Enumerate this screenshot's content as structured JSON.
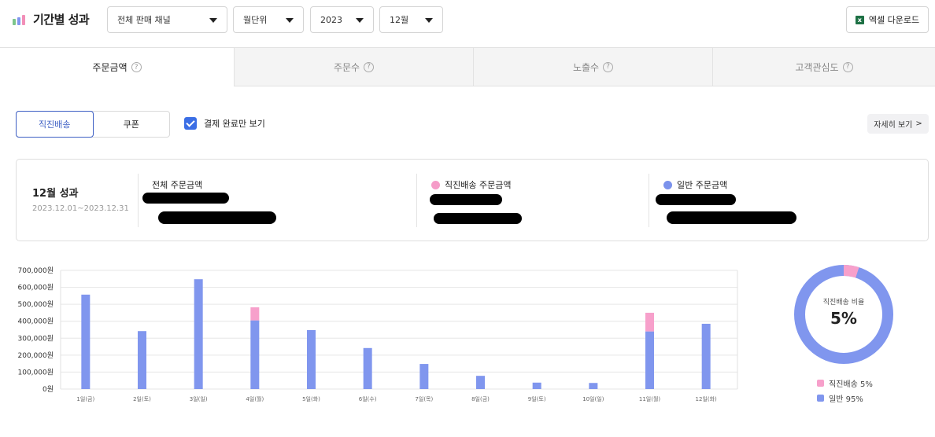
{
  "header": {
    "title": "기간별 성과",
    "channel_select": "전체 판매 채널",
    "unit_select": "월단위",
    "year_select": "2023",
    "month_select": "12월",
    "excel_button": "엑셀 다운로드",
    "excel_icon_text": "x"
  },
  "tabs": [
    {
      "label": "주문금액",
      "active": true
    },
    {
      "label": "주문수",
      "active": false
    },
    {
      "label": "노출수",
      "active": false
    },
    {
      "label": "고객관심도",
      "active": false
    }
  ],
  "help_glyph": "?",
  "filters": {
    "segment": [
      "직진배송",
      "쿠폰"
    ],
    "checkbox_label": "결제 완료만 보기",
    "checkbox_checked": true,
    "detail_button": "자세히 보기",
    "detail_chevron": ">"
  },
  "summary": {
    "title": "12월 성과",
    "range": "2023.12.01~2023.12.31",
    "metrics": [
      {
        "label": "전체 주문금액"
      },
      {
        "label": "직진배송 주문금액",
        "color": "#f59cc8"
      },
      {
        "label": "일반 주문금액",
        "color": "#7b92ec"
      }
    ]
  },
  "colors": {
    "direct": "#f7a0cb",
    "normal": "#8096ee",
    "accent": "#3d5fc4"
  },
  "chart_data": {
    "type": "bar",
    "stacked": true,
    "categories": [
      "1일(금)",
      "2일(토)",
      "3일(일)",
      "4일(월)",
      "5일(화)",
      "6일(수)",
      "7일(목)",
      "8일(금)",
      "9일(토)",
      "10일(일)",
      "11일(월)",
      "12일(화)"
    ],
    "series": [
      {
        "key": "normal",
        "values": [
          557000,
          342000,
          648000,
          405000,
          348000,
          242000,
          148000,
          78000,
          38000,
          36000,
          340000,
          385000
        ]
      },
      {
        "key": "direct",
        "values": [
          0,
          0,
          0,
          77000,
          0,
          0,
          0,
          0,
          0,
          0,
          110000,
          0
        ]
      }
    ],
    "yticks": [
      "700,000원",
      "600,000원",
      "500,000원",
      "400,000원",
      "300,000원",
      "200,000원",
      "100,000원",
      "0원"
    ],
    "ylim": [
      0,
      700000
    ],
    "grid": true
  },
  "donut": {
    "label": "직진배송 비율",
    "value": "5%",
    "direct_fraction": 0.05,
    "legend": [
      "직진배송 5%",
      "일반 95%"
    ]
  }
}
